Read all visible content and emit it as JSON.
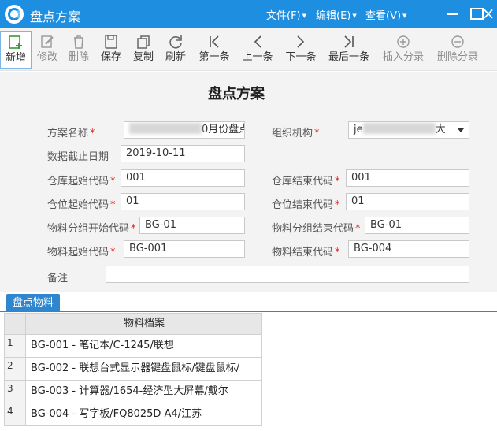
{
  "app": {
    "title": "盘点方案"
  },
  "menus": [
    {
      "label": "文件(F)"
    },
    {
      "label": "编辑(E)"
    },
    {
      "label": "查看(V)"
    }
  ],
  "toolbar": {
    "buttons": [
      {
        "id": "new",
        "label": "新增",
        "icon": "add-doc-icon"
      },
      {
        "id": "edit",
        "label": "修改",
        "icon": "pencil-icon"
      },
      {
        "id": "delete",
        "label": "删除",
        "icon": "trash-icon"
      },
      {
        "id": "save",
        "label": "保存",
        "icon": "floppy-icon"
      },
      {
        "id": "copy",
        "label": "复制",
        "icon": "copy-icon"
      },
      {
        "id": "refresh",
        "label": "刷新",
        "icon": "refresh-icon"
      },
      {
        "id": "first",
        "label": "第一条",
        "icon": "first-icon"
      },
      {
        "id": "prev",
        "label": "上一条",
        "icon": "prev-icon"
      },
      {
        "id": "next",
        "label": "下一条",
        "icon": "next-icon"
      },
      {
        "id": "last",
        "label": "最后一条",
        "icon": "last-icon"
      },
      {
        "id": "insert",
        "label": "插入分录",
        "icon": "plus-circle-icon"
      },
      {
        "id": "remove",
        "label": "删除分录",
        "icon": "minus-circle-icon"
      }
    ]
  },
  "form": {
    "title": "盘点方案",
    "required_mark": "*",
    "plan_name": {
      "label": "方案名称",
      "value_suffix": "0月份盘点"
    },
    "org": {
      "label": "组织机构",
      "value_prefix": "je",
      "value_suffix": "大"
    },
    "cutoff_date": {
      "label": "数据截止日期",
      "value": "2019-10-11"
    },
    "warehouse_start": {
      "label": "仓库起始代码",
      "value": "001"
    },
    "warehouse_end": {
      "label": "仓库结束代码",
      "value": "001"
    },
    "location_start": {
      "label": "仓位起始代码",
      "value": "01"
    },
    "location_end": {
      "label": "仓位结束代码",
      "value": "01"
    },
    "group_start": {
      "label": "物料分组开始代码",
      "value": "BG-01"
    },
    "group_end": {
      "label": "物料分组结束代码",
      "value": "BG-01"
    },
    "material_start": {
      "label": "物料起始代码",
      "value": "BG-001"
    },
    "material_end": {
      "label": "物料结束代码",
      "value": "BG-004"
    },
    "remark": {
      "label": "备注",
      "value": ""
    }
  },
  "tabs": [
    {
      "label": "盘点物料"
    }
  ],
  "grid": {
    "column": "物料档案",
    "rows": [
      {
        "num": "1",
        "value": "BG-001 - 笔记本/C-1245/联想"
      },
      {
        "num": "2",
        "value": "BG-002 - 联想台式显示器键盘鼠标/键盘鼠标/"
      },
      {
        "num": "3",
        "value": "BG-003 - 计算器/1654-经济型大屏幕/戴尔"
      },
      {
        "num": "4",
        "value": "BG-004 - 写字板/FQ8025D  A4/江苏"
      }
    ]
  }
}
